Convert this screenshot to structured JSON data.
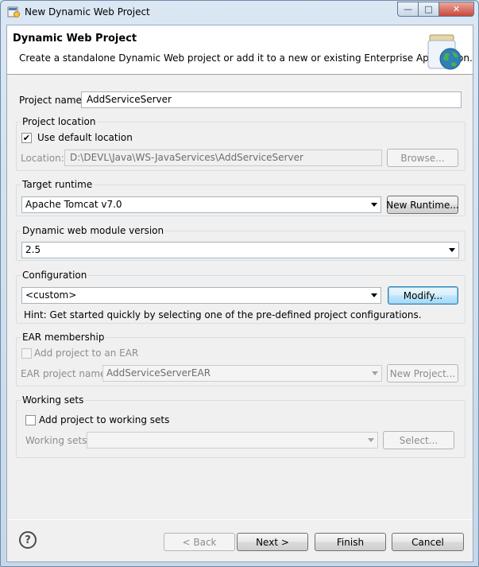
{
  "window": {
    "title": "New Dynamic Web Project"
  },
  "header": {
    "title": "Dynamic Web Project",
    "description": "Create a standalone Dynamic Web project or add it to a new or existing Enterprise Application."
  },
  "project_name": {
    "label": "Project name:",
    "value": "AddServiceServer"
  },
  "project_location": {
    "group_title": "Project location",
    "use_default_label": "Use default location",
    "use_default_checked": true,
    "location_label": "Location:",
    "location_value": "D:\\DEVL\\Java\\WS-JavaServices\\AddServiceServer",
    "browse_label": "Browse..."
  },
  "target_runtime": {
    "group_title": "Target runtime",
    "selected": "Apache Tomcat v7.0",
    "new_runtime_label": "New Runtime..."
  },
  "module_version": {
    "group_title": "Dynamic web module version",
    "selected": "2.5"
  },
  "configuration": {
    "group_title": "Configuration",
    "selected": "<custom>",
    "modify_label": "Modify...",
    "hint": "Hint: Get started quickly by selecting one of the pre-defined project configurations."
  },
  "ear_membership": {
    "group_title": "EAR membership",
    "add_label": "Add project to an EAR",
    "add_checked": false,
    "ear_name_label": "EAR project name:",
    "ear_name_value": "AddServiceServerEAR",
    "new_project_label": "New Project..."
  },
  "working_sets": {
    "group_title": "Working sets",
    "add_label": "Add project to working sets",
    "add_checked": false,
    "sets_label": "Working sets:",
    "sets_value": "",
    "select_label": "Select..."
  },
  "footer": {
    "help_symbol": "?",
    "back_label": "< Back",
    "next_label": "Next >",
    "finish_label": "Finish",
    "cancel_label": "Cancel"
  },
  "icons": {
    "app": "eclipse-wizard-icon",
    "header_art": "web-project-globe-jar-icon",
    "help": "help-icon"
  }
}
